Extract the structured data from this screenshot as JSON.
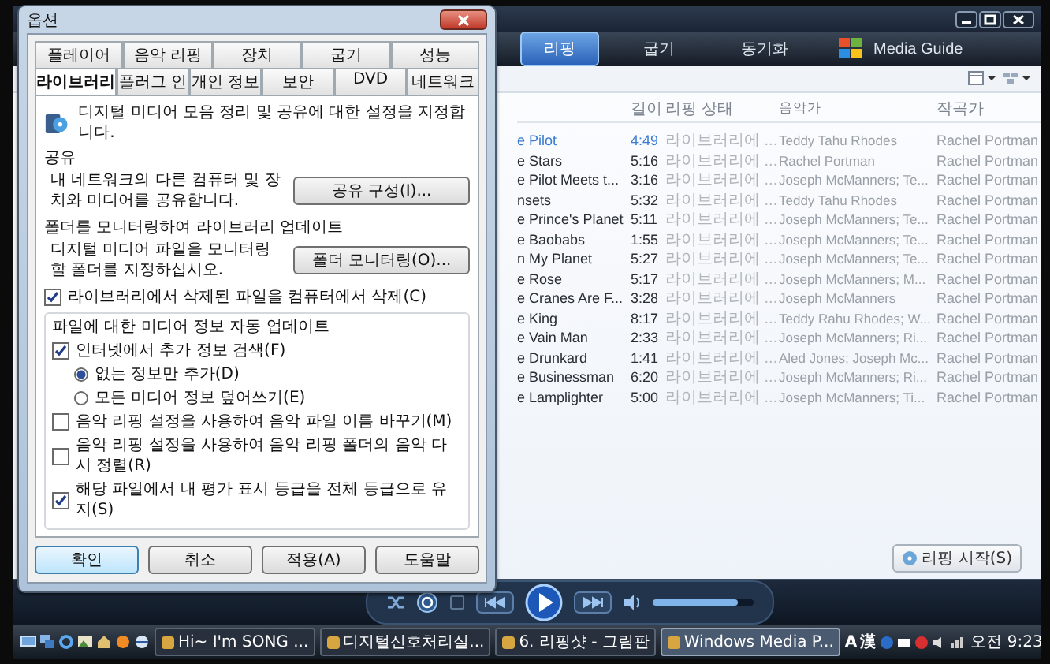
{
  "dialog": {
    "title": "옵션",
    "tabs_row_1": [
      {
        "label": "플레이어",
        "selected": false
      },
      {
        "label": "음악 리핑",
        "selected": false
      },
      {
        "label": "장치",
        "selected": false
      },
      {
        "label": "굽기",
        "selected": false
      },
      {
        "label": "성능",
        "selected": false
      }
    ],
    "tabs_row_2": [
      {
        "label": "라이브러리",
        "selected": true
      },
      {
        "label": "플러그 인",
        "selected": false
      },
      {
        "label": "개인 정보",
        "selected": false
      },
      {
        "label": "보안",
        "selected": false
      },
      {
        "label": "DVD",
        "selected": false
      },
      {
        "label": "네트워크",
        "selected": false
      }
    ],
    "intro": "디지털 미디어 모음 정리 및 공유에 대한 설정을 지정합니다.",
    "sharing": {
      "heading": "공유",
      "text": "내 네트워크의 다른 컴퓨터 및 장치와 미디어를 공유합니다.",
      "button": "공유 구성(I)..."
    },
    "monitoring": {
      "heading": "폴더를 모니터링하여 라이브러리 업데이트",
      "text": "디지털 미디어 파일을 모니터링할 폴더를 지정하십시오.",
      "button": "폴더 모니터링(O)..."
    },
    "delete_option": {
      "label": "라이브러리에서 삭제된 파일을 컴퓨터에서 삭제(C)",
      "checked": true
    },
    "auto_update": {
      "heading": "파일에 대한 미디어 정보 자동 업데이트",
      "options": [
        {
          "kind": "checkbox",
          "label": "인터넷에서 추가 정보 검색(F)",
          "checked": true
        },
        {
          "kind": "radio",
          "label": "없는 정보만 추가(D)",
          "selected": true
        },
        {
          "kind": "radio",
          "label": "모든 미디어 정보 덮어쓰기(E)",
          "selected": false
        },
        {
          "kind": "checkbox",
          "label": "음악 리핑 설정을 사용하여 음악 파일 이름 바꾸기(M)",
          "checked": false
        },
        {
          "kind": "checkbox",
          "label": "음악 리핑 설정을 사용하여 음악 리핑 폴더의 음악 다시 정렬(R)",
          "checked": false
        },
        {
          "kind": "checkbox",
          "label": "해당 파일에서 내 평가 표시 등급을 전체 등급으로 유지(S)",
          "checked": true
        }
      ]
    },
    "buttons": [
      {
        "label": "확인",
        "default": true
      },
      {
        "label": "취소",
        "default": false
      },
      {
        "label": "적용(A)",
        "default": false
      },
      {
        "label": "도움말",
        "default": false
      }
    ]
  },
  "player": {
    "nav_tabs": [
      {
        "kind": "text",
        "label": "리핑",
        "selected": true
      },
      {
        "kind": "text",
        "label": "굽기",
        "selected": false
      },
      {
        "kind": "text",
        "label": "동기화",
        "selected": false
      },
      {
        "kind": "guide",
        "label": "Media Guide",
        "selected": false
      }
    ],
    "columns": [
      "길이",
      "리핑 상태",
      "음악가",
      "작곡가"
    ],
    "rows": [
      {
        "title": "e Pilot",
        "length": "4:49",
        "status": "라이브러리에 ...",
        "artist": "Teddy Tahu Rhodes",
        "composer": "Rachel Portman",
        "playing": true
      },
      {
        "title": "e Stars",
        "length": "5:16",
        "status": "라이브러리에 ...",
        "artist": "Rachel Portman",
        "composer": "Rachel Portman",
        "playing": false
      },
      {
        "title": "e Pilot Meets t...",
        "length": "3:16",
        "status": "라이브러리에 ...",
        "artist": "Joseph McManners; Te...",
        "composer": "Rachel Portman",
        "playing": false
      },
      {
        "title": "nsets",
        "length": "5:32",
        "status": "라이브러리에 ...",
        "artist": "Teddy Tahu Rhodes",
        "composer": "Rachel Portman",
        "playing": false
      },
      {
        "title": "e Prince's Planet",
        "length": "5:11",
        "status": "라이브러리에 ...",
        "artist": "Joseph McManners; Te...",
        "composer": "Rachel Portman",
        "playing": false
      },
      {
        "title": "e Baobabs",
        "length": "1:55",
        "status": "라이브러리에 ...",
        "artist": "Joseph McManners; Te...",
        "composer": "Rachel Portman",
        "playing": false
      },
      {
        "title": "n My Planet",
        "length": "5:27",
        "status": "라이브러리에 ...",
        "artist": "Joseph McManners; Te...",
        "composer": "Rachel Portman",
        "playing": false
      },
      {
        "title": "e Rose",
        "length": "5:17",
        "status": "라이브러리에 ...",
        "artist": "Joseph McManners; M...",
        "composer": "Rachel Portman",
        "playing": false
      },
      {
        "title": "e Cranes Are F...",
        "length": "3:28",
        "status": "라이브러리에 ...",
        "artist": "Joseph McManners",
        "composer": "Rachel Portman",
        "playing": false
      },
      {
        "title": "e King",
        "length": "8:17",
        "status": "라이브러리에 ...",
        "artist": "Teddy Rahu Rhodes; W...",
        "composer": "Rachel Portman",
        "playing": false
      },
      {
        "title": "e Vain Man",
        "length": "2:33",
        "status": "라이브러리에 ...",
        "artist": "Joseph McManners; Ri...",
        "composer": "Rachel Portman",
        "playing": false
      },
      {
        "title": "e Drunkard",
        "length": "1:41",
        "status": "라이브러리에 ...",
        "artist": "Aled Jones; Joseph Mc...",
        "composer": "Rachel Portman",
        "playing": false
      },
      {
        "title": "e Businessman",
        "length": "6:20",
        "status": "라이브러리에 ...",
        "artist": "Joseph McManners; Ri...",
        "composer": "Rachel Portman",
        "playing": false
      },
      {
        "title": "e Lamplighter",
        "length": "5:00",
        "status": "라이브러리에 ...",
        "artist": "Joseph McManners; Ti...",
        "composer": "Rachel Portman",
        "playing": false
      }
    ],
    "rip_button": "리핑 시작(S)",
    "volume": {
      "level": 0.85
    }
  },
  "taskbar": {
    "tasks": [
      {
        "label": "Hi~ I'm SONG ...",
        "selected": false
      },
      {
        "label": "디지털신호처리실...",
        "selected": false
      },
      {
        "label": "6. 리핑샷 - 그림판",
        "selected": false
      },
      {
        "label": "Windows Media P...",
        "selected": true
      }
    ],
    "ime": [
      "A",
      "漢"
    ],
    "clock": "오전 9:23"
  }
}
